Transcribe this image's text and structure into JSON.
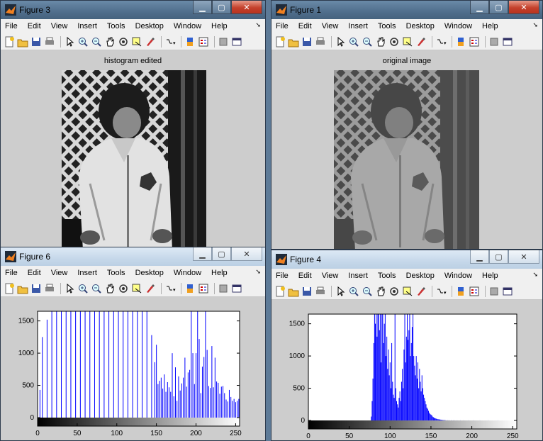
{
  "menu_items": [
    "File",
    "Edit",
    "View",
    "Insert",
    "Tools",
    "Desktop",
    "Window",
    "Help"
  ],
  "windows": {
    "figure3": {
      "title": "Figure 3",
      "axes_title": "histogram edited"
    },
    "figure1": {
      "title": "Figure 1",
      "axes_title": "original image"
    },
    "figure6": {
      "title": "Figure 6"
    },
    "figure4": {
      "title": "Figure 4"
    }
  },
  "icons": [
    "new-figure-icon",
    "open-icon",
    "save-icon",
    "print-icon",
    "pointer-icon",
    "zoom-in-icon",
    "zoom-out-icon",
    "pan-icon",
    "rotate-3d-icon",
    "data-cursor-icon",
    "brush-icon",
    "link-icon",
    "colorbar-icon",
    "legend-icon",
    "hide-tools-icon",
    "show-tools-icon"
  ],
  "colors": {
    "bar": "#0000ff",
    "figure_bg": "#cdcdcd",
    "titlebar_active": "#506e8c"
  },
  "chart_data": [
    {
      "id": "figure6",
      "type": "bar",
      "xlim": [
        0,
        255
      ],
      "ylim": [
        0,
        1650
      ],
      "xticks": [
        0,
        50,
        100,
        150,
        200,
        250
      ],
      "yticks": [
        0,
        500,
        1000,
        1500
      ],
      "x": [
        3,
        6,
        12,
        18,
        24,
        30,
        36,
        42,
        48,
        54,
        60,
        66,
        72,
        78,
        84,
        90,
        96,
        102,
        108,
        114,
        120,
        126,
        132,
        138,
        144,
        148,
        150,
        152,
        154,
        156,
        158,
        160,
        162,
        164,
        166,
        168,
        170,
        172,
        174,
        176,
        178,
        180,
        182,
        184,
        186,
        188,
        190,
        192,
        194,
        196,
        198,
        200,
        202,
        204,
        206,
        208,
        210,
        212,
        214,
        216,
        218,
        220,
        222,
        224,
        226,
        228,
        230,
        232,
        234,
        236,
        238,
        240,
        242,
        244,
        246,
        248,
        250,
        252,
        254
      ],
      "y": [
        430,
        1250,
        1520,
        1650,
        1650,
        1650,
        1650,
        1650,
        1650,
        1650,
        1650,
        1650,
        1650,
        1650,
        1650,
        1650,
        1650,
        1650,
        1650,
        1650,
        1650,
        1650,
        1650,
        1650,
        1280,
        860,
        1130,
        520,
        570,
        620,
        450,
        670,
        400,
        550,
        470,
        400,
        1000,
        330,
        780,
        260,
        640,
        420,
        530,
        620,
        930,
        480,
        700,
        740,
        1650,
        1000,
        520,
        1000,
        1650,
        1220,
        380,
        790,
        940,
        1650,
        1050,
        490,
        460,
        1110,
        470,
        930,
        560,
        540,
        370,
        480,
        490,
        380,
        280,
        250,
        430,
        320,
        260,
        290,
        240,
        260,
        290
      ]
    },
    {
      "id": "figure4",
      "type": "bar",
      "xlim": [
        0,
        255
      ],
      "ylim": [
        0,
        1650
      ],
      "xticks": [
        0,
        50,
        100,
        150,
        200,
        250
      ],
      "yticks": [
        0,
        500,
        1000,
        1500
      ],
      "x": [
        77,
        78,
        79,
        80,
        81,
        82,
        83,
        84,
        85,
        86,
        87,
        88,
        89,
        90,
        91,
        92,
        93,
        94,
        95,
        96,
        97,
        98,
        99,
        100,
        101,
        102,
        103,
        104,
        105,
        106,
        107,
        108,
        109,
        110,
        111,
        112,
        113,
        114,
        115,
        116,
        117,
        118,
        119,
        120,
        121,
        122,
        123,
        124,
        125,
        126,
        127,
        128,
        129,
        130,
        131,
        132,
        133,
        134,
        135,
        136,
        137,
        138,
        139,
        140,
        141,
        142,
        143,
        144,
        145,
        146,
        147,
        148,
        149,
        150,
        151,
        152,
        153,
        154,
        155,
        156,
        157,
        158,
        159,
        160,
        161,
        162,
        163,
        164,
        165,
        166,
        167,
        168,
        170,
        172,
        175,
        178,
        182,
        186,
        190,
        196,
        202,
        210,
        220,
        232
      ],
      "y": [
        60,
        300,
        650,
        1200,
        1650,
        1500,
        1650,
        1300,
        1650,
        1650,
        1400,
        1650,
        900,
        1650,
        1650,
        1200,
        1500,
        1650,
        1000,
        1300,
        800,
        1100,
        700,
        900,
        500,
        1200,
        600,
        400,
        350,
        1650,
        500,
        300,
        250,
        200,
        350,
        450,
        300,
        600,
        800,
        500,
        1100,
        1650,
        900,
        1300,
        1650,
        1250,
        1400,
        1650,
        1000,
        1200,
        1450,
        1650,
        1000,
        850,
        700,
        1000,
        650,
        900,
        500,
        800,
        600,
        450,
        700,
        500,
        400,
        350,
        300,
        250,
        200,
        180,
        150,
        120,
        100,
        90,
        80,
        60,
        50,
        40,
        35,
        30,
        25,
        20,
        18,
        16,
        14,
        12,
        10,
        8,
        6,
        5,
        4,
        3,
        3,
        2,
        2,
        2,
        1,
        1,
        1,
        1,
        1,
        1,
        1,
        1
      ]
    }
  ]
}
